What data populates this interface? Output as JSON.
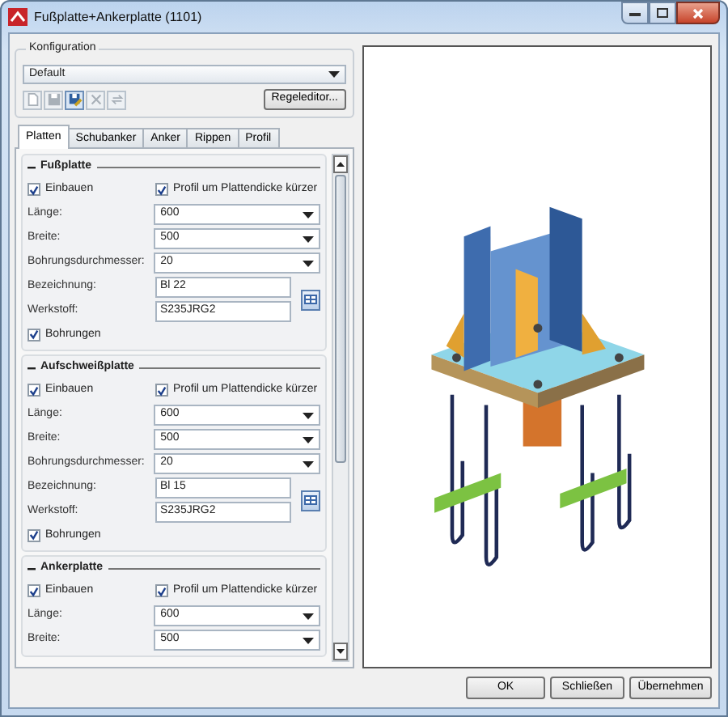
{
  "window": {
    "title": "Fußplatte+Ankerplatte (1101)"
  },
  "configuration": {
    "label": "Konfiguration",
    "value": "Default",
    "rule_editor": "Regeleditor...",
    "toolbar": [
      {
        "kind": "new",
        "disabled": true
      },
      {
        "kind": "save",
        "disabled": true
      },
      {
        "kind": "save_as",
        "disabled": false
      },
      {
        "kind": "delete",
        "disabled": true
      },
      {
        "kind": "refresh",
        "disabled": true
      }
    ]
  },
  "tabs": [
    {
      "label": "Platten",
      "selected": true
    },
    {
      "label": "Schubanker",
      "selected": false
    },
    {
      "label": "Anker",
      "selected": false
    },
    {
      "label": "Rippen",
      "selected": false
    },
    {
      "label": "Profil",
      "selected": false
    }
  ],
  "sections": [
    {
      "title": "Fußplatte",
      "install": {
        "label": "Einbauen",
        "checked": true
      },
      "shorten": {
        "label": "Profil um Plattendicke kürzer",
        "checked": true
      },
      "selects": [
        {
          "label": "Länge:",
          "value": "600"
        },
        {
          "label": "Breite:",
          "value": "500"
        },
        {
          "label": "Bohrungsdurchmesser:",
          "value": "20"
        }
      ],
      "text_fields": [
        {
          "label": "Bezeichnung:",
          "value": "Bl 22"
        },
        {
          "label": "Werkstoff:",
          "value": "S235JRG2"
        }
      ],
      "holes": {
        "label": "Bohrungen",
        "checked": true
      }
    },
    {
      "title": "Aufschweißplatte",
      "install": {
        "label": "Einbauen",
        "checked": true
      },
      "shorten": {
        "label": "Profil um Plattendicke kürzer",
        "checked": true
      },
      "selects": [
        {
          "label": "Länge:",
          "value": "600"
        },
        {
          "label": "Breite:",
          "value": "500"
        },
        {
          "label": "Bohrungsdurchmesser:",
          "value": "20"
        }
      ],
      "text_fields": [
        {
          "label": "Bezeichnung:",
          "value": "Bl 15"
        },
        {
          "label": "Werkstoff:",
          "value": "S235JRG2"
        }
      ],
      "holes": {
        "label": "Bohrungen",
        "checked": true
      }
    },
    {
      "title": "Ankerplatte",
      "install": {
        "label": "Einbauen",
        "checked": true
      },
      "shorten": {
        "label": "Profil um Plattendicke kürzer",
        "checked": true
      },
      "selects": [
        {
          "label": "Länge:",
          "value": "600"
        },
        {
          "label": "Breite:",
          "value": "500"
        }
      ]
    }
  ],
  "buttons": [
    {
      "label": "OK"
    },
    {
      "label": "Schließen"
    },
    {
      "label": "Übernehmen"
    }
  ]
}
